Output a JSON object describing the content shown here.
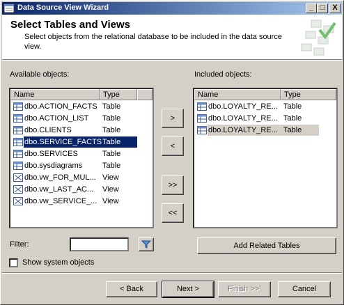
{
  "window": {
    "title": "Data Source View Wizard",
    "min_label": "_",
    "max_label": "□",
    "close_label": "X"
  },
  "header": {
    "title": "Select Tables and Views",
    "subtitle": "Select objects from the relational database to be included in the data source view."
  },
  "available": {
    "label": "Available objects:",
    "columns": [
      "Name",
      "Type"
    ],
    "rows": [
      {
        "name": "dbo.ACTION_FACTS",
        "type": "Table",
        "icon": "table-icon"
      },
      {
        "name": "dbo.ACTION_LIST",
        "type": "Table",
        "icon": "table-icon"
      },
      {
        "name": "dbo.CLIENTS",
        "type": "Table",
        "icon": "table-icon"
      },
      {
        "name": "dbo.SERVICE_FACTS",
        "type": "Table",
        "icon": "table-icon",
        "selected": true
      },
      {
        "name": "dbo.SERVICES",
        "type": "Table",
        "icon": "table-icon"
      },
      {
        "name": "dbo.sysdiagrams",
        "type": "Table",
        "icon": "table-icon"
      },
      {
        "name": "dbo.vw_FOR_MUL...",
        "type": "View",
        "icon": "view-icon"
      },
      {
        "name": "dbo.vw_LAST_AC...",
        "type": "View",
        "icon": "view-icon"
      },
      {
        "name": "dbo.vw_SERVICE_...",
        "type": "View",
        "icon": "view-icon"
      }
    ]
  },
  "included": {
    "label": "Included objects:",
    "columns": [
      "Name",
      "Type"
    ],
    "rows": [
      {
        "name": "dbo.LOYALTY_RE...",
        "type": "Table",
        "icon": "table-icon"
      },
      {
        "name": "dbo.LOYALTY_RE...",
        "type": "Table",
        "icon": "table-icon"
      },
      {
        "name": "dbo.LOYALTY_RE...",
        "type": "Table",
        "icon": "table-icon",
        "selected": true
      }
    ]
  },
  "transfer": {
    "add": ">",
    "remove": "<",
    "add_all": ">>",
    "remove_all": "<<"
  },
  "filter": {
    "label": "Filter:",
    "value": ""
  },
  "add_related_label": "Add Related Tables",
  "show_system_label": "Show system objects",
  "footer": {
    "back": "< Back",
    "next": "Next >",
    "finish": "Finish >>|",
    "cancel": "Cancel"
  },
  "colors": {
    "title_start": "#0a246a",
    "title_end": "#a6caf0",
    "selection": "#0a246a",
    "face": "#d4d0c8"
  }
}
